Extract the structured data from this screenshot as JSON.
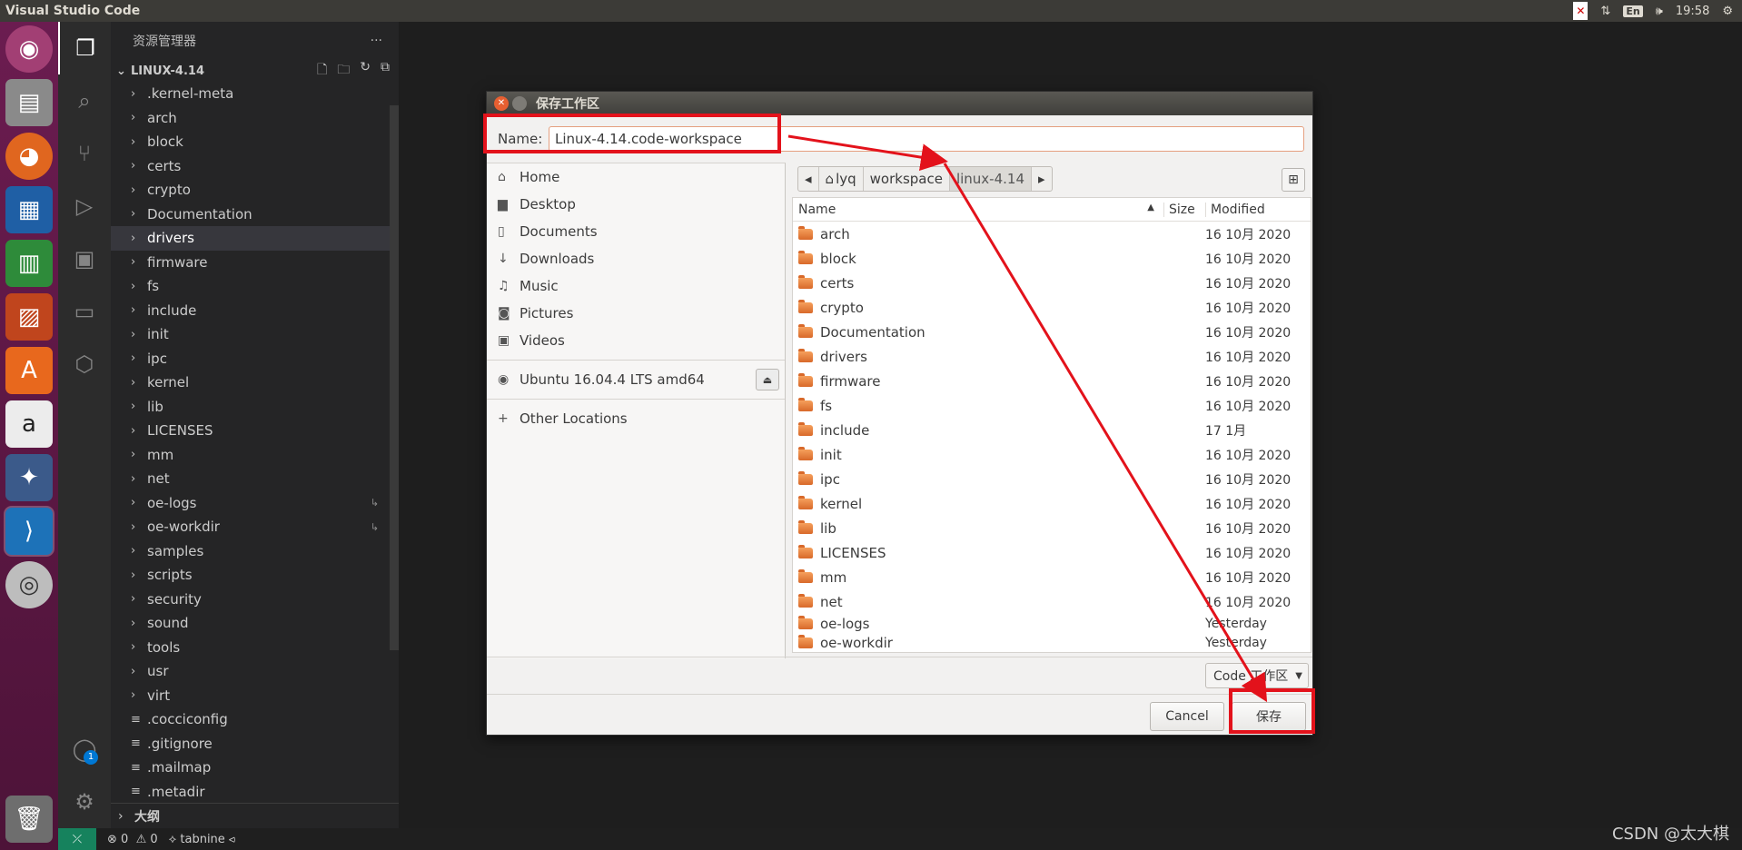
{
  "top_panel": {
    "title": "Visual Studio Code",
    "lang": "En",
    "time": "19:58"
  },
  "sidebar": {
    "title": "资源管理器",
    "folder": "LINUX-4.14",
    "items": [
      {
        "label": ".kernel-meta",
        "type": "dir"
      },
      {
        "label": "arch",
        "type": "dir"
      },
      {
        "label": "block",
        "type": "dir"
      },
      {
        "label": "certs",
        "type": "dir"
      },
      {
        "label": "crypto",
        "type": "dir"
      },
      {
        "label": "Documentation",
        "type": "dir"
      },
      {
        "label": "drivers",
        "type": "dir",
        "selected": true
      },
      {
        "label": "firmware",
        "type": "dir"
      },
      {
        "label": "fs",
        "type": "dir"
      },
      {
        "label": "include",
        "type": "dir"
      },
      {
        "label": "init",
        "type": "dir"
      },
      {
        "label": "ipc",
        "type": "dir"
      },
      {
        "label": "kernel",
        "type": "dir"
      },
      {
        "label": "lib",
        "type": "dir"
      },
      {
        "label": "LICENSES",
        "type": "dir"
      },
      {
        "label": "mm",
        "type": "dir"
      },
      {
        "label": "net",
        "type": "dir"
      },
      {
        "label": "oe-logs",
        "type": "dir",
        "link": true
      },
      {
        "label": "oe-workdir",
        "type": "dir",
        "link": true
      },
      {
        "label": "samples",
        "type": "dir"
      },
      {
        "label": "scripts",
        "type": "dir"
      },
      {
        "label": "security",
        "type": "dir"
      },
      {
        "label": "sound",
        "type": "dir"
      },
      {
        "label": "tools",
        "type": "dir"
      },
      {
        "label": "usr",
        "type": "dir"
      },
      {
        "label": "virt",
        "type": "dir"
      },
      {
        "label": ".cocciconfig",
        "type": "file"
      },
      {
        "label": ".gitignore",
        "type": "file"
      },
      {
        "label": ".mailmap",
        "type": "file"
      },
      {
        "label": ".metadir",
        "type": "file"
      }
    ],
    "outline": "大纲"
  },
  "status": {
    "problems": "0",
    "warnings": "0",
    "tabnine": "tabnine"
  },
  "watermark": "CSDN @太大棋",
  "dialog": {
    "title": "保存工作区",
    "name_label": "Name:",
    "name_value": "Linux-4.14.code-workspace",
    "places": [
      {
        "label": "Home",
        "icon": "home-icon",
        "glyph": "⌂"
      },
      {
        "label": "Desktop",
        "icon": "desktop-folder-icon",
        "glyph": "▆"
      },
      {
        "label": "Documents",
        "icon": "document-icon",
        "glyph": "▯"
      },
      {
        "label": "Downloads",
        "icon": "download-icon",
        "glyph": "↓"
      },
      {
        "label": "Music",
        "icon": "music-icon",
        "glyph": "♫"
      },
      {
        "label": "Pictures",
        "icon": "camera-icon",
        "glyph": "◙"
      },
      {
        "label": "Videos",
        "icon": "video-icon",
        "glyph": "▣"
      }
    ],
    "device": "Ubuntu 16.04.4 LTS amd64",
    "other": "Other Locations",
    "path": [
      "lyq",
      "workspace",
      "linux-4.14"
    ],
    "columns": {
      "name": "Name",
      "size": "Size",
      "modified": "Modified"
    },
    "files": [
      {
        "name": "arch",
        "modified": "16 10月 2020"
      },
      {
        "name": "block",
        "modified": "16 10月 2020"
      },
      {
        "name": "certs",
        "modified": "16 10月 2020"
      },
      {
        "name": "crypto",
        "modified": "16 10月 2020"
      },
      {
        "name": "Documentation",
        "modified": "16 10月 2020"
      },
      {
        "name": "drivers",
        "modified": "16 10月 2020"
      },
      {
        "name": "firmware",
        "modified": "16 10月 2020"
      },
      {
        "name": "fs",
        "modified": "16 10月 2020"
      },
      {
        "name": "include",
        "modified": "17 1月"
      },
      {
        "name": "init",
        "modified": "16 10月 2020"
      },
      {
        "name": "ipc",
        "modified": "16 10月 2020"
      },
      {
        "name": "kernel",
        "modified": "16 10月 2020"
      },
      {
        "name": "lib",
        "modified": "16 10月 2020"
      },
      {
        "name": "LICENSES",
        "modified": "16 10月 2020"
      },
      {
        "name": "mm",
        "modified": "16 10月 2020"
      },
      {
        "name": "net",
        "modified": "16 10月 2020"
      },
      {
        "name": "oe-logs",
        "modified": "Yesterday"
      },
      {
        "name": "oe-workdir",
        "modified": "Yesterday"
      }
    ],
    "filter": "Code 工作区",
    "cancel": "Cancel",
    "save": "保存"
  },
  "colors": {
    "annotation": "#e3121b",
    "launcher": "#5a1744",
    "status_remote": "#16825d"
  }
}
